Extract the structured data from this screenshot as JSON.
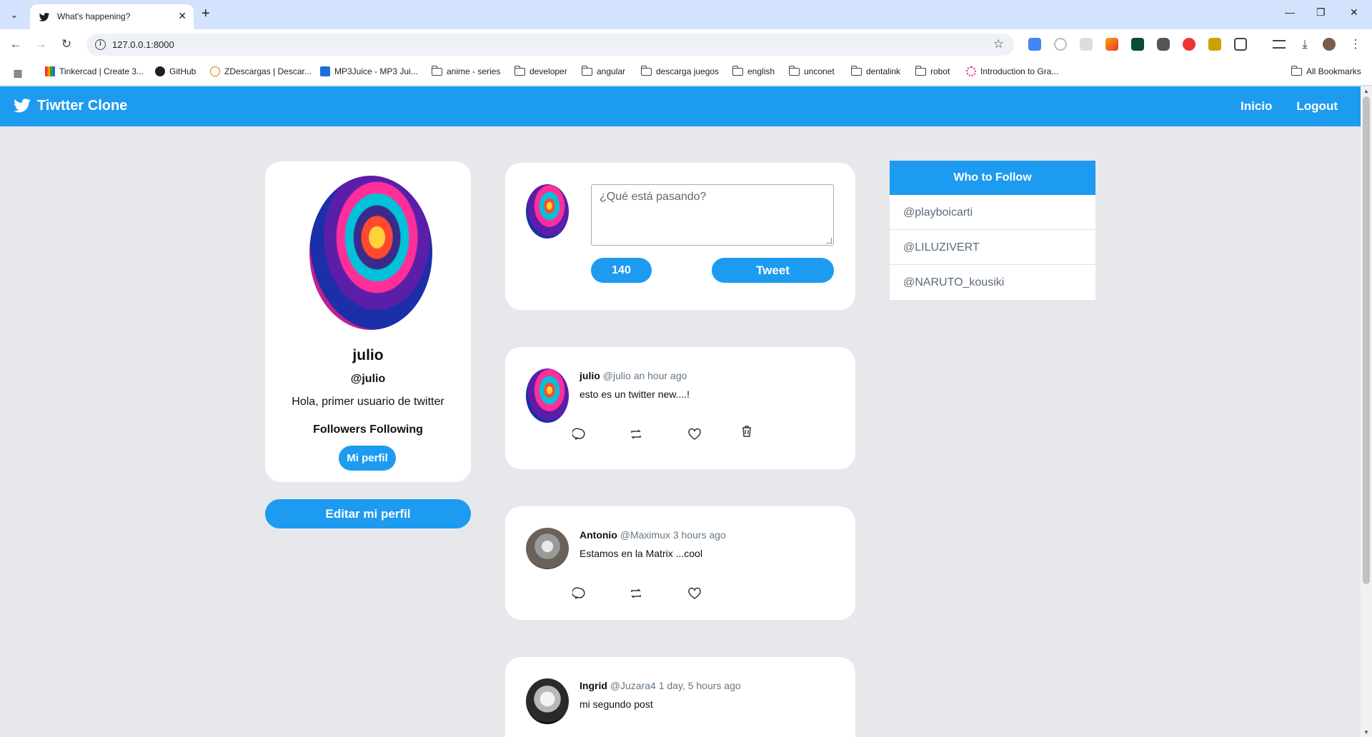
{
  "browser": {
    "tab_title": "What's happening?",
    "url": "127.0.0.1:8000",
    "bookmarks": [
      {
        "label": "Tinkercad | Create 3...",
        "icon": "tinkercad-icon"
      },
      {
        "label": "GitHub",
        "icon": "github-icon"
      },
      {
        "label": "ZDescargas | Descar...",
        "icon": "zdescargas-icon"
      },
      {
        "label": "MP3Juice - MP3 Jui...",
        "icon": "mp3juice-icon"
      },
      {
        "label": "anime - series",
        "icon": "folder-icon"
      },
      {
        "label": "developer",
        "icon": "folder-icon"
      },
      {
        "label": "angular",
        "icon": "folder-icon"
      },
      {
        "label": "descarga juegos",
        "icon": "folder-icon"
      },
      {
        "label": "english",
        "icon": "folder-icon"
      },
      {
        "label": "unconet",
        "icon": "folder-icon"
      },
      {
        "label": "dentalink",
        "icon": "folder-icon"
      },
      {
        "label": "robot",
        "icon": "folder-icon"
      },
      {
        "label": "Introduction to Gra...",
        "icon": "flower-icon"
      }
    ],
    "all_bookmarks": "All Bookmarks"
  },
  "navbar": {
    "brand": "Tiwtter Clone",
    "links": [
      "Inicio",
      "Logout"
    ]
  },
  "profile": {
    "name": "julio",
    "handle": "@julio",
    "bio": "Hola, primer usuario de twitter",
    "follow_label": "Followers Following",
    "my_profile_button": "Mi perfil",
    "edit_button": "Editar mi perfil"
  },
  "compose": {
    "placeholder": "¿Qué está pasando?",
    "counter": "140",
    "tweet_button": "Tweet"
  },
  "tweets": [
    {
      "name": "julio",
      "handle": "@julio",
      "time": "an hour ago",
      "text": "esto es un twitter new....!",
      "deletable": true
    },
    {
      "name": "Antonio",
      "handle": "@Maximux",
      "time": "3 hours ago",
      "text": "Estamos en la Matrix ...cool",
      "deletable": false
    },
    {
      "name": "Ingrid",
      "handle": "@Juzara4",
      "time": "1 day, 5 hours ago",
      "text": "mi segundo post",
      "deletable": false
    }
  ],
  "who_to_follow": {
    "title": "Who to Follow",
    "users": [
      "@playboicarti",
      "@LILUZIVERT",
      "@NARUTO_kousiki"
    ]
  },
  "colors": {
    "accent": "#1d9bf0",
    "background": "#e6e8eb"
  }
}
